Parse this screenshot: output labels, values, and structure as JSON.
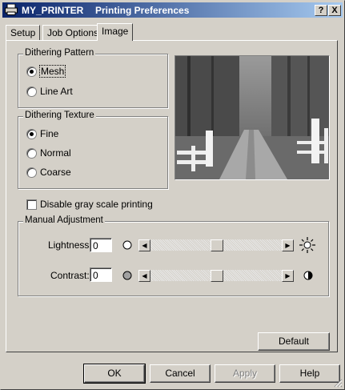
{
  "titlebar": {
    "app_name": "MY_PRINTER",
    "title": "Printing Preferences",
    "help_label": "?",
    "close_label": "X"
  },
  "tabs": [
    {
      "label": "Setup"
    },
    {
      "label": "Job Options"
    },
    {
      "label": "Image",
      "active": true
    }
  ],
  "dithering_pattern": {
    "label": "Dithering Pattern",
    "options": [
      {
        "label": "Mesh",
        "checked": true
      },
      {
        "label": "Line Art",
        "checked": false
      }
    ]
  },
  "dithering_texture": {
    "label": "Dithering Texture",
    "options": [
      {
        "label": "Fine",
        "checked": true
      },
      {
        "label": "Normal",
        "checked": false
      },
      {
        "label": "Coarse",
        "checked": false
      }
    ]
  },
  "disable_gray": {
    "label": "Disable gray scale printing",
    "checked": false
  },
  "manual_adjustment": {
    "label": "Manual Adjustment",
    "lightness": {
      "label": "Lightness:",
      "value": "0",
      "slider_level": 0.5
    },
    "contrast": {
      "label": "Contrast:",
      "value": "0",
      "slider_level": 0.5
    }
  },
  "buttons": {
    "default": "Default",
    "ok": "OK",
    "cancel": "Cancel",
    "apply": "Apply",
    "help": "Help"
  }
}
